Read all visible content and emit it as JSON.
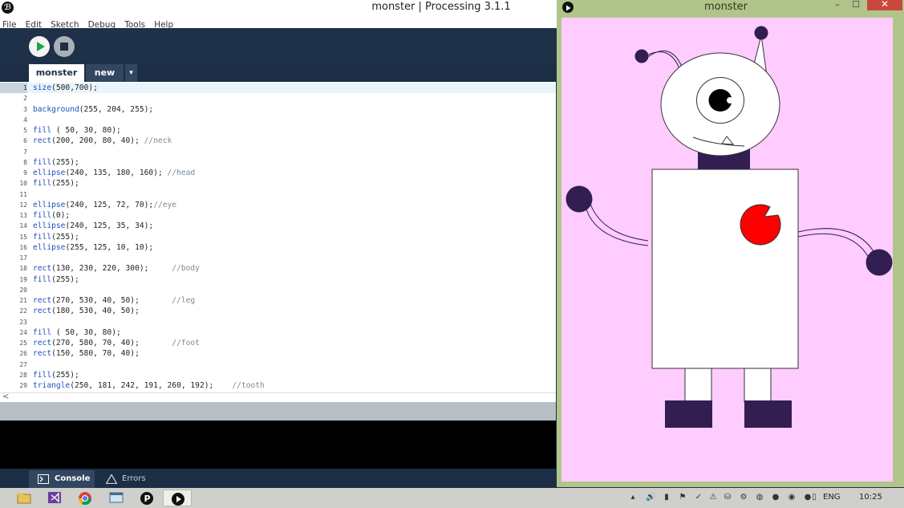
{
  "ide": {
    "title": "monster | Processing 3.1.1",
    "logo_glyph": "ℬ",
    "menu": [
      "File",
      "Edit",
      "Sketch",
      "Debug",
      "Tools",
      "Help"
    ],
    "tabs": {
      "active": "monster",
      "inactive": "new",
      "menu_glyph": "▾"
    },
    "current_line": 1,
    "code": [
      [
        {
          "t": "size",
          "k": "kw"
        },
        {
          "t": "(500,700);"
        }
      ],
      [],
      [
        {
          "t": "background",
          "k": "kw"
        },
        {
          "t": "(255, 204, 255);"
        }
      ],
      [],
      [
        {
          "t": "fill",
          "k": "kw"
        },
        {
          "t": " ( 50, 30, 80);"
        }
      ],
      [
        {
          "t": "rect",
          "k": "kw"
        },
        {
          "t": "(200, 200, 80, 40); "
        },
        {
          "t": "//neck",
          "k": "cm"
        }
      ],
      [],
      [
        {
          "t": "fill",
          "k": "kw"
        },
        {
          "t": "(255);"
        }
      ],
      [
        {
          "t": "ellipse",
          "k": "kw"
        },
        {
          "t": "(240, 135, 180, 160); "
        },
        {
          "t": "//head",
          "k": "cm"
        }
      ],
      [
        {
          "t": "fill",
          "k": "kw"
        },
        {
          "t": "(255);"
        }
      ],
      [],
      [
        {
          "t": "ellipse",
          "k": "kw"
        },
        {
          "t": "(240, 125, 72, 70);"
        },
        {
          "t": "//eye",
          "k": "cm"
        }
      ],
      [
        {
          "t": "fill",
          "k": "kw"
        },
        {
          "t": "(0);"
        }
      ],
      [
        {
          "t": "ellipse",
          "k": "kw"
        },
        {
          "t": "(240, 125, 35, 34);"
        }
      ],
      [
        {
          "t": "fill",
          "k": "kw"
        },
        {
          "t": "(255);"
        }
      ],
      [
        {
          "t": "ellipse",
          "k": "kw"
        },
        {
          "t": "(255, 125, 10, 10);"
        }
      ],
      [],
      [
        {
          "t": "rect",
          "k": "kw"
        },
        {
          "t": "(130, 230, 220, 300);     "
        },
        {
          "t": "//body",
          "k": "cm"
        }
      ],
      [
        {
          "t": "fill",
          "k": "kw"
        },
        {
          "t": "(255);"
        }
      ],
      [],
      [
        {
          "t": "rect",
          "k": "kw"
        },
        {
          "t": "(270, 530, 40, 50);       "
        },
        {
          "t": "//leg",
          "k": "cm"
        }
      ],
      [
        {
          "t": "rect",
          "k": "kw"
        },
        {
          "t": "(180, 530, 40, 50);"
        }
      ],
      [],
      [
        {
          "t": "fill",
          "k": "kw"
        },
        {
          "t": " ( 50, 30, 80);"
        }
      ],
      [
        {
          "t": "rect",
          "k": "kw"
        },
        {
          "t": "(270, 580, 70, 40);       "
        },
        {
          "t": "//foot",
          "k": "cm"
        }
      ],
      [
        {
          "t": "rect",
          "k": "kw"
        },
        {
          "t": "(150, 580, 70, 40);"
        }
      ],
      [],
      [
        {
          "t": "fill",
          "k": "kw"
        },
        {
          "t": "(255);"
        }
      ],
      [
        {
          "t": "triangle",
          "k": "kw"
        },
        {
          "t": "(250, 181, 242, 191, 260, 192);    "
        },
        {
          "t": "//tooth",
          "k": "cm"
        }
      ]
    ],
    "console_tab": "Console",
    "errors_tab": "Errors",
    "scroll_arrow": "<"
  },
  "sketch": {
    "title": "monster",
    "min_glyph": "–",
    "max_glyph": "☐",
    "close_glyph": "✕",
    "background": "#ffccff",
    "dark_fill": "#321e50",
    "pacman_fill": "#ff0000"
  },
  "taskbar": {
    "apps": [
      "file-explorer-icon",
      "visual-studio-icon",
      "chrome-icon",
      "window-icon",
      "processing-icon",
      "processing-sketch-icon"
    ],
    "language": "ENG",
    "clock": "10:25",
    "tray_glyphs": [
      "▴",
      "🔊",
      "▮",
      "⚑",
      "✓",
      "⚠",
      "⛁",
      "⚙",
      "◍",
      "●",
      "◉",
      "●",
      "▯"
    ]
  },
  "colors": {
    "ide_bg": "#1c2e45",
    "keyword": "#1f4fbf",
    "comment": "#7a8b99",
    "sketch_frame": "#b1c58b"
  }
}
